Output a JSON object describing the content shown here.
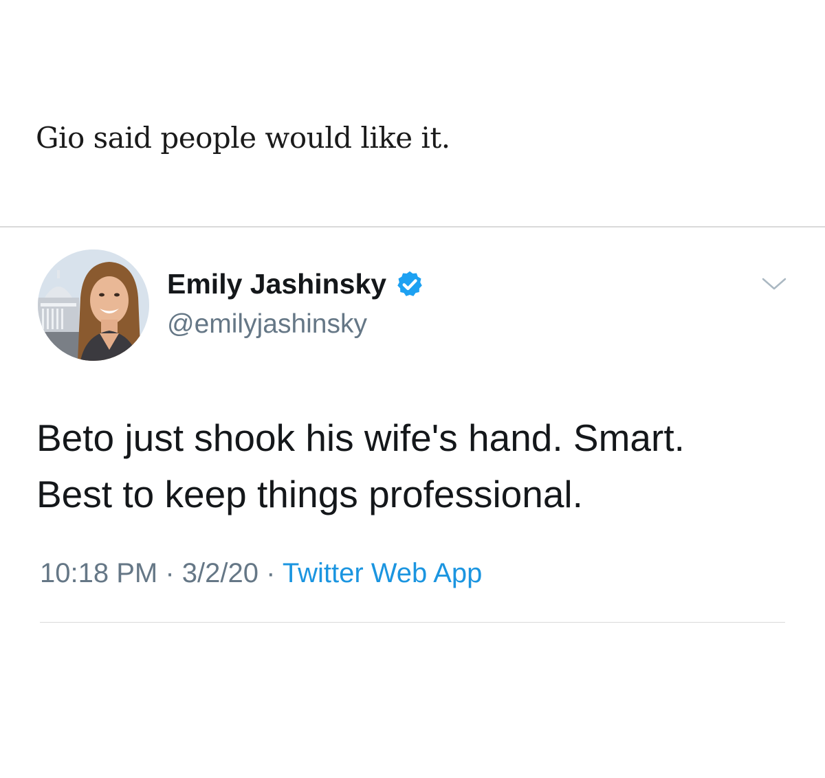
{
  "caption": "Gio said people would like it.",
  "tweet": {
    "display_name": "Emily Jashinsky",
    "handle": "@emilyjashinsky",
    "verified": true,
    "text_lines": [
      "Beto just shook his wife's hand. Smart.",
      "Best to keep things professional."
    ],
    "time": "10:18 PM",
    "separator": "·",
    "date": "3/2/20",
    "source": "Twitter Web App",
    "icons": {
      "verified": "verified-badge-icon",
      "menu": "chevron-down-icon"
    }
  },
  "colors": {
    "verified_blue": "#1da1f2",
    "link_blue": "#1b95e0",
    "secondary_text": "#657786",
    "primary_text": "#14171a"
  }
}
